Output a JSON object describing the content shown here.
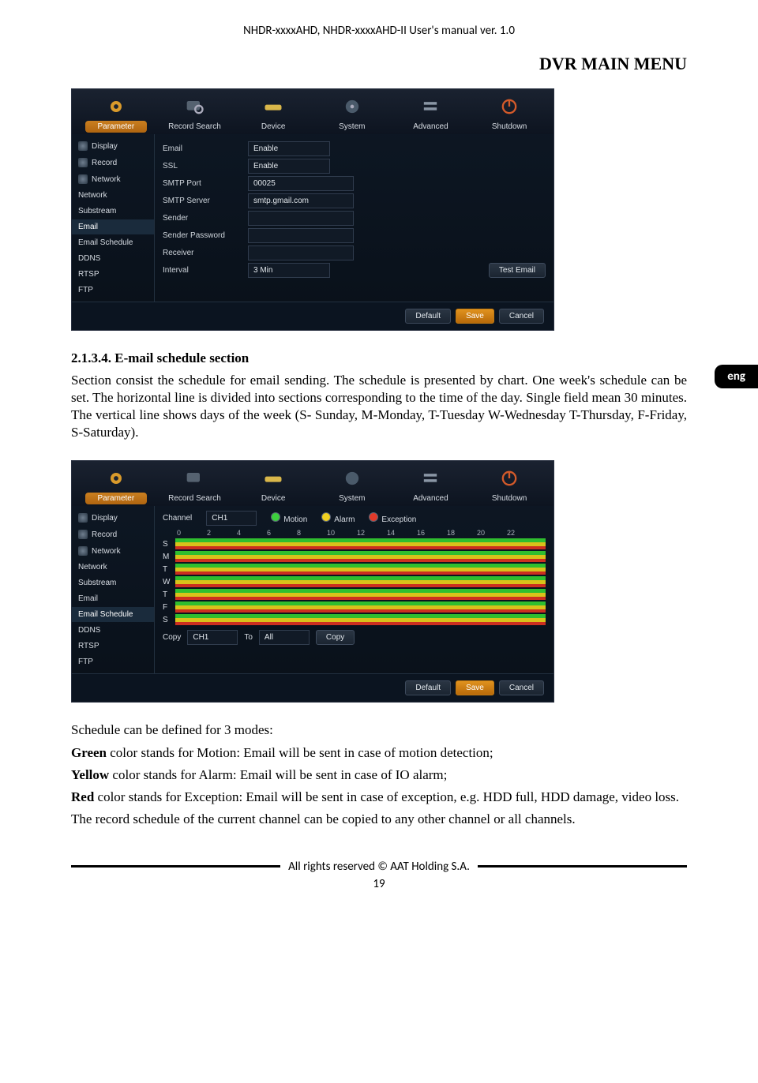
{
  "header": "NHDR-xxxxAHD, NHDR-xxxxAHD-II User's manual ver. 1.0",
  "sectionTitle": "DVR MAIN MENU",
  "langTab": "eng",
  "s1": {
    "heading": "2.1.3.4. E-mail schedule section",
    "p1": "Section consist the schedule for email sending. The schedule is presented by chart. One week's schedule can be set. The horizontal line is divided into sections corresponding to the time of the day. Single field mean 30 minutes. The vertical line shows days of the week (S- Sunday, M-Monday, T-Tuesday W-Wednesday T-Thursday, F-Friday, S-Saturday)."
  },
  "s2": {
    "p1": "Schedule can be defined for 3 modes:",
    "p2a": "Green",
    "p2b": " color stands for Motion: Email will be sent in case of motion detection;",
    "p3a": "Yellow",
    "p3b": " color stands for Alarm: Email will be sent in case of IO alarm;",
    "p4a": "Red",
    "p4b": " color stands for Exception: Email will be sent in case of exception, e.g. HDD full, HDD damage, video loss.",
    "p5": "The record schedule of the current channel can be copied to any other channel or all channels."
  },
  "tabs": [
    "Parameter",
    "Record Search",
    "Device",
    "System",
    "Advanced",
    "Shutdown"
  ],
  "sidebar": [
    "Display",
    "Record",
    "Network",
    "Network",
    "Substream",
    "Email",
    "Email Schedule",
    "DDNS",
    "RTSP",
    "FTP"
  ],
  "emailForm": {
    "emailLabel": "Email",
    "emailVal": "Enable",
    "sslLabel": "SSL",
    "sslVal": "Enable",
    "portLabel": "SMTP Port",
    "portVal": "00025",
    "serverLabel": "SMTP Server",
    "serverVal": "smtp.gmail.com",
    "senderLabel": "Sender",
    "senderVal": "",
    "pwdLabel": "Sender Password",
    "pwdVal": "",
    "recvLabel": "Receiver",
    "recvVal": "",
    "intLabel": "Interval",
    "intVal": "3 Min",
    "testBtn": "Test Email"
  },
  "sched": {
    "chanLabel": "Channel",
    "chanVal": "CH1",
    "motion": "Motion",
    "alarm": "Alarm",
    "exception": "Exception",
    "hours": [
      "0",
      "2",
      "4",
      "6",
      "8",
      "10",
      "12",
      "14",
      "16",
      "18",
      "20",
      "22"
    ],
    "days": [
      "S",
      "M",
      "T",
      "W",
      "T",
      "F",
      "S"
    ],
    "copyLabel": "Copy",
    "copyFrom": "CH1",
    "toLabel": "To",
    "toVal": "All",
    "copyBtn": "Copy"
  },
  "footerBtns": {
    "default": "Default",
    "save": "Save",
    "cancel": "Cancel"
  },
  "footerText": "All rights reserved © AAT Holding S.A.",
  "pageNum": "19"
}
